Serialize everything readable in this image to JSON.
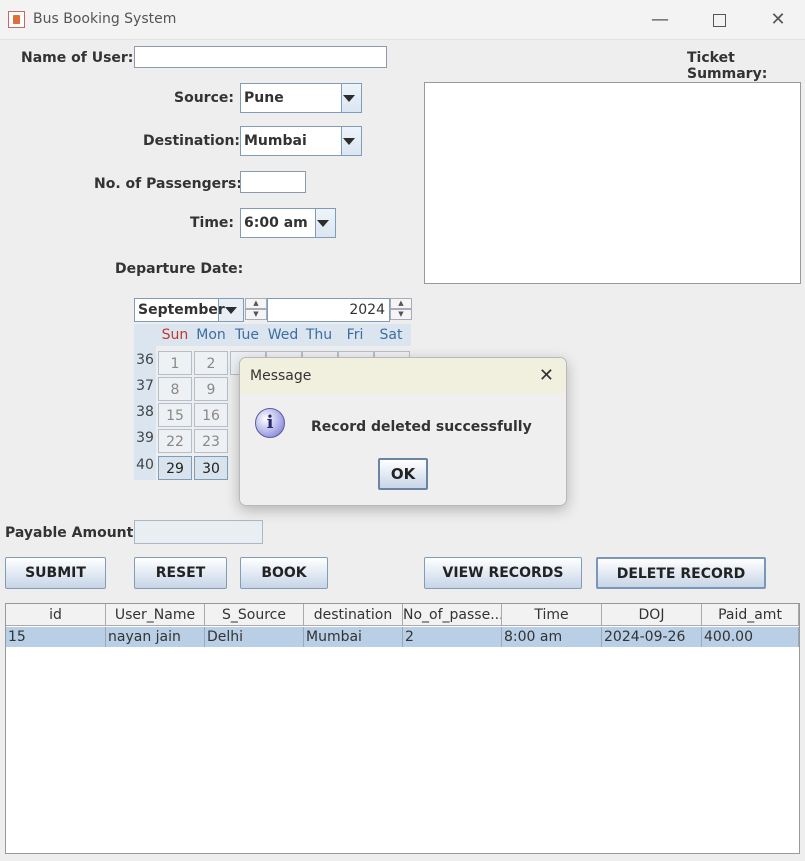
{
  "window": {
    "title": "Bus Booking System"
  },
  "form": {
    "name_label": "Name of User:",
    "name_value": "",
    "source_label": "Source:",
    "source_value": "Pune",
    "destination_label": "Destination:",
    "destination_value": "Mumbai",
    "passengers_label": "No. of Passengers:",
    "passengers_value": "",
    "time_label": "Time:",
    "time_value": "6:00 am",
    "departure_label": "Departure Date:",
    "payable_label": "Payable Amount:",
    "payable_value": ""
  },
  "ticket_summary": {
    "label": "Ticket Summary:"
  },
  "calendar": {
    "month": "September",
    "year": "2024",
    "weekdays": [
      "Sun",
      "Mon",
      "Tue",
      "Wed",
      "Thu",
      "Fri",
      "Sat"
    ],
    "week_numbers": [
      "36",
      "37",
      "38",
      "39",
      "40"
    ],
    "visible_days": [
      [
        "1",
        "2"
      ],
      [
        "8",
        "9"
      ],
      [
        "15",
        "16"
      ],
      [
        "22",
        "23"
      ],
      [
        "29",
        "30"
      ]
    ],
    "colors": {
      "sunday": "#c0392b",
      "weekday": "#3d6ea0"
    }
  },
  "buttons": {
    "submit": "SUBMIT",
    "reset": "RESET",
    "book": "BOOK",
    "view_records": "VIEW RECORDS",
    "delete_record": "DELETE RECORD"
  },
  "table": {
    "headers": [
      "id",
      "User_Name",
      "S_Source",
      "destination",
      "No_of_passe...",
      "Time",
      "DOJ",
      "Paid_amt"
    ],
    "rows": [
      [
        "15",
        "nayan jain",
        "Delhi",
        "Mumbai",
        "2",
        "8:00 am",
        "2024-09-26",
        "400.00"
      ]
    ],
    "selected_row_color": "#b8cfe5"
  },
  "dialog": {
    "title": "Message",
    "message": "Record deleted successfully",
    "ok": "OK",
    "icon": "info-icon"
  }
}
